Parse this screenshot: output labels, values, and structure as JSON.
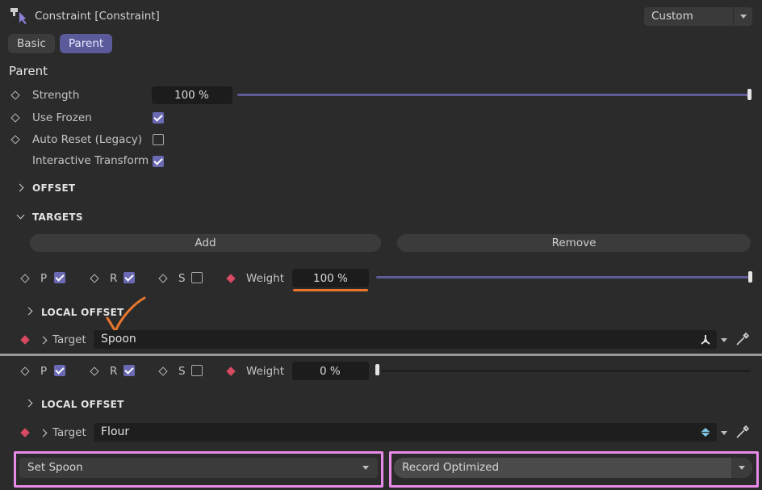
{
  "header": {
    "title": "Constraint [Constraint]",
    "mode_dropdown": "Custom",
    "pin_icon": "pin-icon"
  },
  "tabs": [
    {
      "label": "Basic",
      "active": false
    },
    {
      "label": "Parent",
      "active": true
    }
  ],
  "parent": {
    "section_title": "Parent",
    "strength_label": "Strength",
    "strength_value": "100 %",
    "strength_level": 1.0,
    "use_frozen_label": "Use Frozen",
    "use_frozen": true,
    "auto_reset_label": "Auto Reset (Legacy)",
    "auto_reset": false,
    "interactive_transform_label": "Interactive Transform",
    "interactive_transform": true
  },
  "groups": {
    "offset": "OFFSET",
    "targets": "TARGETS"
  },
  "targets_buttons": {
    "add": "Add",
    "remove": "Remove"
  },
  "targets": [
    {
      "p_label": "P",
      "p": true,
      "r_label": "R",
      "r": true,
      "s_label": "S",
      "s": false,
      "weight_label": "Weight",
      "weight_value": "100 %",
      "weight_level": 1.0,
      "local_offset": "LOCAL OFFSET",
      "target_label": "Target",
      "target_value": "Spoon"
    },
    {
      "p_label": "P",
      "p": true,
      "r_label": "R",
      "r": true,
      "s_label": "S",
      "s": false,
      "weight_label": "Weight",
      "weight_value": "0 %",
      "weight_level": 0.0,
      "local_offset": "LOCAL OFFSET",
      "target_label": "Target",
      "target_value": "Flour"
    }
  ],
  "bottom": {
    "left_dropdown": "Set Spoon",
    "right_dropdown": "Record Optimized"
  },
  "colors": {
    "accent": "#5b5a9b",
    "highlight_box": "#e88ae8",
    "annotation": "#e8762c",
    "keyframe_red": "#d64a62"
  }
}
